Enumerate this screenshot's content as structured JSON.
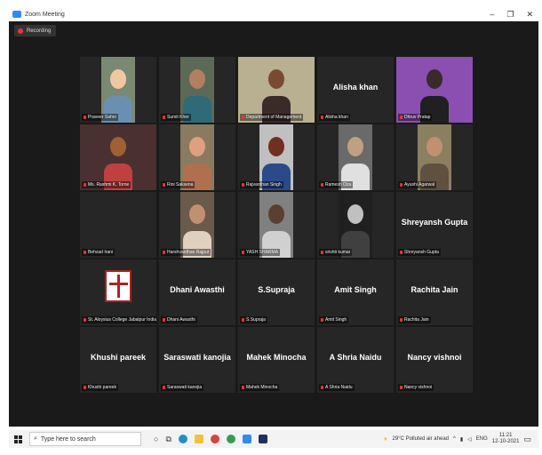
{
  "window": {
    "title": "Zoom Meeting",
    "controls": [
      "–",
      "❐",
      "✕"
    ]
  },
  "recording": {
    "label": "Recording"
  },
  "participants": [
    {
      "name": "Praveer Sahni",
      "video": true,
      "colors": [
        "#7a8a72",
        "#f0c8a0",
        "#6a8fb0"
      ]
    },
    {
      "name": "Sumit Kher",
      "video": true,
      "colors": [
        "#5c6a55",
        "#b08060",
        "#2f6a78"
      ]
    },
    {
      "name": "Department of Management",
      "video": true,
      "active": true,
      "colors": [
        "#b8b090",
        "#7a4a30",
        "#3a2a2a"
      ]
    },
    {
      "name": "Alisha khan",
      "video": false,
      "big": "Alisha khan"
    },
    {
      "name": "Dhruv Pratap",
      "video": true,
      "colors": [
        "#8a4fb0",
        "#3a2a2a",
        "#202020"
      ]
    },
    {
      "name": "Ms. Rashmi K. Torne",
      "video": true,
      "colors": [
        "#4a3030",
        "#a06030",
        "#c04040"
      ]
    },
    {
      "name": "Rini Saksena",
      "video": true,
      "colors": [
        "#8a7a60",
        "#e0a080",
        "#b07050"
      ]
    },
    {
      "name": "Rajvardhan Singh",
      "video": true,
      "colors": [
        "#c0c0c0",
        "#703020",
        "#2a4a8a"
      ]
    },
    {
      "name": "Ramesh Oza",
      "video": true,
      "colors": [
        "#6a6a6a",
        "#c0a080",
        "#e0e0e0"
      ]
    },
    {
      "name": "Ayushi Agarwal",
      "video": true,
      "colors": [
        "#8a8060",
        "#c09070",
        "#605040"
      ]
    },
    {
      "name": "Behzad Irani",
      "video": false,
      "big": ""
    },
    {
      "name": "Harshvardhan Rajput",
      "video": true,
      "colors": [
        "#6a5a4a",
        "#c09070",
        "#e0d0c0"
      ]
    },
    {
      "name": "YASH SHARMA",
      "video": true,
      "colors": [
        "#808080",
        "#5a4030",
        "#d0d0d0"
      ]
    },
    {
      "name": "srishti kumar",
      "video": true,
      "colors": [
        "#202020",
        "#c0c0c0",
        "#404040"
      ]
    },
    {
      "name": "Shreyansh Gupta",
      "video": false,
      "big": "Shreyansh Gupta"
    },
    {
      "name": "St. Aloysius College Jabalpur India",
      "video": false,
      "logo": true
    },
    {
      "name": "Dhani Awasthi",
      "video": false,
      "big": "Dhani Awasthi"
    },
    {
      "name": "S.Supraja",
      "video": false,
      "big": "S.Supraja"
    },
    {
      "name": "Amit Singh",
      "video": false,
      "big": "Amit Singh"
    },
    {
      "name": "Rachita Jain",
      "video": false,
      "big": "Rachita Jain"
    },
    {
      "name": "Khushi pareek",
      "video": false,
      "big": "Khushi pareek"
    },
    {
      "name": "Saraswati kanojia",
      "video": false,
      "big": "Saraswati kanojia"
    },
    {
      "name": "Mahek Minocha",
      "video": false,
      "big": "Mahek Minocha"
    },
    {
      "name": "A Shria Naidu",
      "video": false,
      "big": "A Shria Naidu"
    },
    {
      "name": "Nancy vishnoi",
      "video": false,
      "big": "Nancy vishnoi"
    }
  ],
  "taskbar": {
    "search_placeholder": "Type here to search",
    "weather": "29°C  Polluted air ahead",
    "tray_language": "ENG",
    "time": "11:21",
    "date": "12-10-2021"
  },
  "colors": {
    "zoom_blue": "#2d8cff",
    "active_speaker": "#c7d63a",
    "mic_muted": "#e33333"
  }
}
